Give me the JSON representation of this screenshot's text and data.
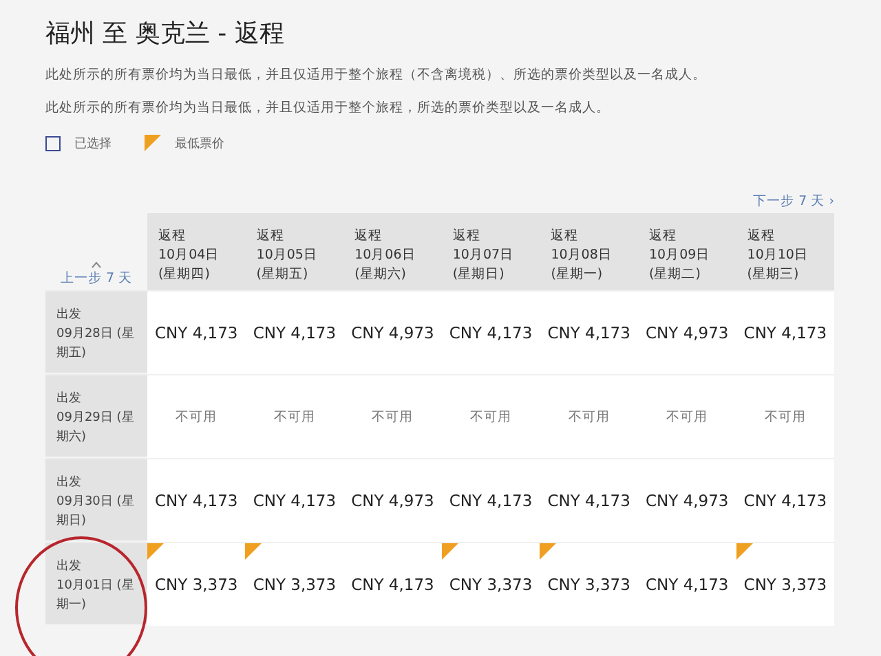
{
  "title": "福州 至 奥克兰 - 返程",
  "notes": [
    "此处所示的所有票价均为当日最低，并且仅适用于整个旅程（不含离境税）、所选的票价类型以及一名成人。",
    "此处所示的所有票价均为当日最低，并且仅适用于整个旅程，所选的票价类型以及一名成人。"
  ],
  "legend": [
    {
      "kind": "selected",
      "label": "已选择"
    },
    {
      "kind": "lowest",
      "label": "最低票价"
    }
  ],
  "next_link": "下一步 7 天 ›",
  "prev_link": "上一步 7 天",
  "columns": [
    {
      "label": "返程",
      "date": "10月04日 (星期四)"
    },
    {
      "label": "返程",
      "date": "10月05日 (星期五)"
    },
    {
      "label": "返程",
      "date": "10月06日 (星期六)"
    },
    {
      "label": "返程",
      "date": "10月07日 (星期日)"
    },
    {
      "label": "返程",
      "date": "10月08日 (星期一)"
    },
    {
      "label": "返程",
      "date": "10月09日 (星期二)"
    },
    {
      "label": "返程",
      "date": "10月10日 (星期三)"
    }
  ],
  "rows": [
    {
      "label": "出发",
      "date": "09月28日 (星期五)",
      "cells": [
        {
          "kind": "price",
          "text": "CNY 4,173",
          "lowest": false
        },
        {
          "kind": "price",
          "text": "CNY 4,173",
          "lowest": false
        },
        {
          "kind": "price",
          "text": "CNY 4,973",
          "lowest": false
        },
        {
          "kind": "price",
          "text": "CNY 4,173",
          "lowest": false
        },
        {
          "kind": "price",
          "text": "CNY 4,173",
          "lowest": false
        },
        {
          "kind": "price",
          "text": "CNY 4,973",
          "lowest": false
        },
        {
          "kind": "price",
          "text": "CNY 4,173",
          "lowest": false
        }
      ]
    },
    {
      "label": "出发",
      "date": "09月29日 (星期六)",
      "cells": [
        {
          "kind": "unavailable",
          "text": "不可用",
          "lowest": false
        },
        {
          "kind": "unavailable",
          "text": "不可用",
          "lowest": false
        },
        {
          "kind": "unavailable",
          "text": "不可用",
          "lowest": false
        },
        {
          "kind": "unavailable",
          "text": "不可用",
          "lowest": false
        },
        {
          "kind": "unavailable",
          "text": "不可用",
          "lowest": false
        },
        {
          "kind": "unavailable",
          "text": "不可用",
          "lowest": false
        },
        {
          "kind": "unavailable",
          "text": "不可用",
          "lowest": false
        }
      ]
    },
    {
      "label": "出发",
      "date": "09月30日 (星期日)",
      "cells": [
        {
          "kind": "price",
          "text": "CNY 4,173",
          "lowest": false
        },
        {
          "kind": "price",
          "text": "CNY 4,173",
          "lowest": false
        },
        {
          "kind": "price",
          "text": "CNY 4,973",
          "lowest": false
        },
        {
          "kind": "price",
          "text": "CNY 4,173",
          "lowest": false
        },
        {
          "kind": "price",
          "text": "CNY 4,173",
          "lowest": false
        },
        {
          "kind": "price",
          "text": "CNY 4,973",
          "lowest": false
        },
        {
          "kind": "price",
          "text": "CNY 4,173",
          "lowest": false
        }
      ]
    },
    {
      "label": "出发",
      "date": "10月01日 (星期一)",
      "cells": [
        {
          "kind": "price",
          "text": "CNY 3,373",
          "lowest": true
        },
        {
          "kind": "price",
          "text": "CNY 3,373",
          "lowest": true
        },
        {
          "kind": "price",
          "text": "CNY 4,173",
          "lowest": false
        },
        {
          "kind": "price",
          "text": "CNY 3,373",
          "lowest": true
        },
        {
          "kind": "price",
          "text": "CNY 3,373",
          "lowest": true
        },
        {
          "kind": "price",
          "text": "CNY 4,173",
          "lowest": false
        },
        {
          "kind": "price",
          "text": "CNY 3,373",
          "lowest": true
        }
      ]
    }
  ]
}
